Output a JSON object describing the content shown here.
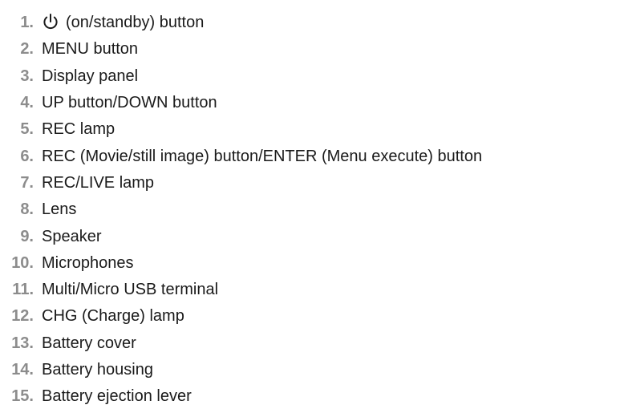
{
  "parts": [
    {
      "number": "1.",
      "label": "(on/standby) button",
      "icon": "power-icon"
    },
    {
      "number": "2.",
      "label": "MENU button"
    },
    {
      "number": "3.",
      "label": "Display panel"
    },
    {
      "number": "4.",
      "label": "UP button/DOWN button"
    },
    {
      "number": "5.",
      "label": "REC lamp"
    },
    {
      "number": "6.",
      "label": "REC (Movie/still image) button/ENTER (Menu execute) button"
    },
    {
      "number": "7.",
      "label": "REC/LIVE lamp"
    },
    {
      "number": "8.",
      "label": "Lens"
    },
    {
      "number": "9.",
      "label": "Speaker"
    },
    {
      "number": "10.",
      "label": "Microphones"
    },
    {
      "number": "11.",
      "label": "Multi/Micro USB terminal"
    },
    {
      "number": "12.",
      "label": "CHG (Charge) lamp"
    },
    {
      "number": "13.",
      "label": "Battery cover"
    },
    {
      "number": "14.",
      "label": "Battery housing"
    },
    {
      "number": "15.",
      "label": "Battery ejection lever"
    }
  ],
  "colors": {
    "number": "#8c8c8c",
    "text": "#1a1a1a"
  }
}
